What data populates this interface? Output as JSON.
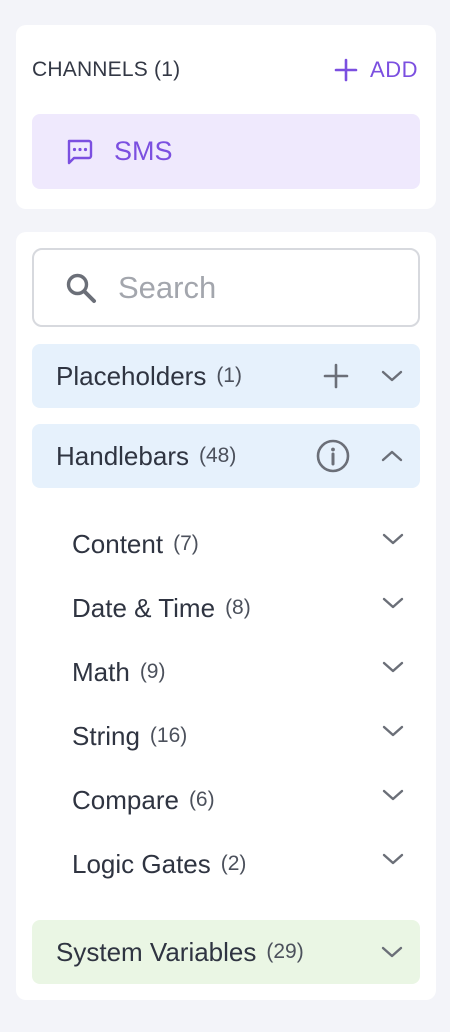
{
  "channels": {
    "title": "CHANNELS (1)",
    "add_label": "ADD",
    "items": [
      {
        "label": "SMS",
        "icon": "message-icon"
      }
    ]
  },
  "search": {
    "placeholder": "Search",
    "value": ""
  },
  "sections": {
    "placeholders": {
      "label": "Placeholders",
      "count": "(1)",
      "expanded": false
    },
    "handlebars": {
      "label": "Handlebars",
      "count": "(48)",
      "expanded": true,
      "groups": [
        {
          "label": "Content",
          "count": "(7)"
        },
        {
          "label": "Date & Time",
          "count": "(8)"
        },
        {
          "label": "Math",
          "count": "(9)"
        },
        {
          "label": "String",
          "count": "(16)"
        },
        {
          "label": "Compare",
          "count": "(6)"
        },
        {
          "label": "Logic Gates",
          "count": "(2)"
        }
      ]
    },
    "system_variables": {
      "label": "System Variables",
      "count": "(29)",
      "expanded": false
    }
  },
  "colors": {
    "accent": "#7b4fe0",
    "accent_bg": "#efe9fd",
    "blue_bg": "#e6f1fc",
    "green_bg": "#eaf6e4",
    "page_bg": "#f3f4f9"
  }
}
